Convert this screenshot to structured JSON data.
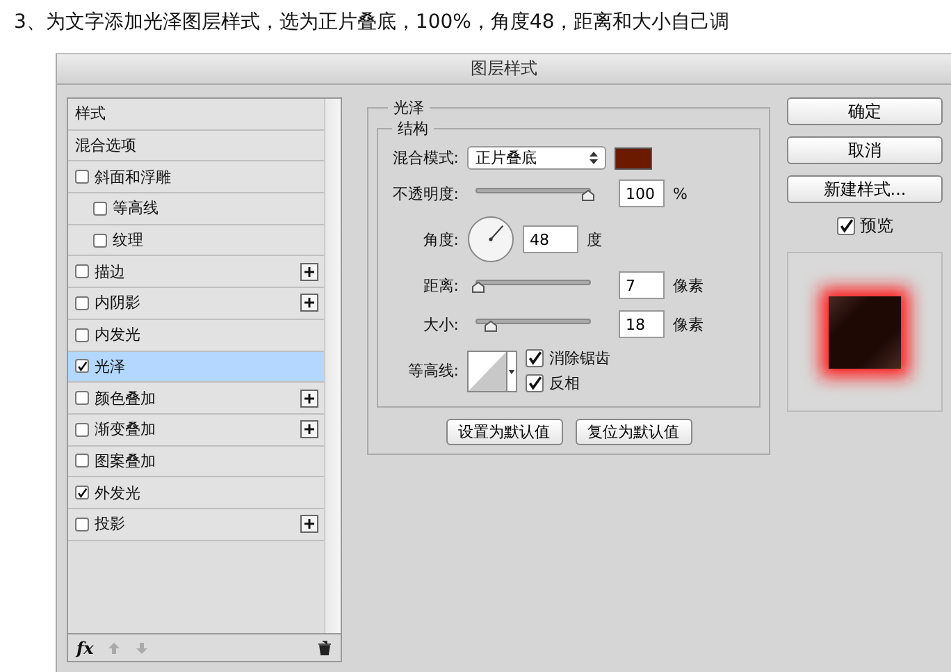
{
  "caption": "3、为文字添加光泽图层样式，选为正片叠底，100%，角度48，距离和大小自己调",
  "window": {
    "title": "图层样式"
  },
  "styles": [
    {
      "label": "样式",
      "kind": "header",
      "selected": false
    },
    {
      "label": "混合选项",
      "kind": "header",
      "selected": false
    },
    {
      "label": "斜面和浮雕",
      "kind": "check",
      "checked": false,
      "selected": false,
      "addable": false,
      "children": [
        {
          "label": "等高线",
          "kind": "check",
          "checked": false,
          "selected": false,
          "addable": false
        },
        {
          "label": "纹理",
          "kind": "check",
          "checked": false,
          "selected": false,
          "addable": false
        }
      ]
    },
    {
      "label": "描边",
      "kind": "check",
      "checked": false,
      "selected": false,
      "addable": true
    },
    {
      "label": "内阴影",
      "kind": "check",
      "checked": false,
      "selected": false,
      "addable": true
    },
    {
      "label": "内发光",
      "kind": "check",
      "checked": false,
      "selected": false,
      "addable": false
    },
    {
      "label": "光泽",
      "kind": "check",
      "checked": true,
      "selected": true,
      "addable": false
    },
    {
      "label": "颜色叠加",
      "kind": "check",
      "checked": false,
      "selected": false,
      "addable": true
    },
    {
      "label": "渐变叠加",
      "kind": "check",
      "checked": false,
      "selected": false,
      "addable": true
    },
    {
      "label": "图案叠加",
      "kind": "check",
      "checked": false,
      "selected": false,
      "addable": false
    },
    {
      "label": "外发光",
      "kind": "check",
      "checked": true,
      "selected": false,
      "addable": false
    },
    {
      "label": "投影",
      "kind": "check",
      "checked": false,
      "selected": false,
      "addable": true
    }
  ],
  "list_toolbar": {
    "fx": "fx"
  },
  "panel": {
    "title": "光泽",
    "group": "结构",
    "blend_mode": {
      "label": "混合模式:",
      "value": "正片叠底",
      "color": "#6b1a00"
    },
    "opacity": {
      "label": "不透明度:",
      "level": 0.97,
      "value": "100",
      "unit": "%"
    },
    "angle": {
      "label": "角度:",
      "value": "48",
      "unit": "度"
    },
    "distance": {
      "label": "距离:",
      "level": 0.02,
      "value": "7",
      "unit": "像素"
    },
    "size": {
      "label": "大小:",
      "level": 0.13,
      "value": "18",
      "unit": "像素"
    },
    "contour": {
      "label": "等高线:",
      "options": [
        {
          "label": "消除锯齿",
          "checked": true
        },
        {
          "label": "反相",
          "checked": true
        }
      ]
    },
    "buttons": [
      "设置为默认值",
      "复位为默认值"
    ]
  },
  "actions": [
    "确定",
    "取消",
    "新建样式..."
  ],
  "preview": {
    "label": "预览",
    "checked": true
  }
}
